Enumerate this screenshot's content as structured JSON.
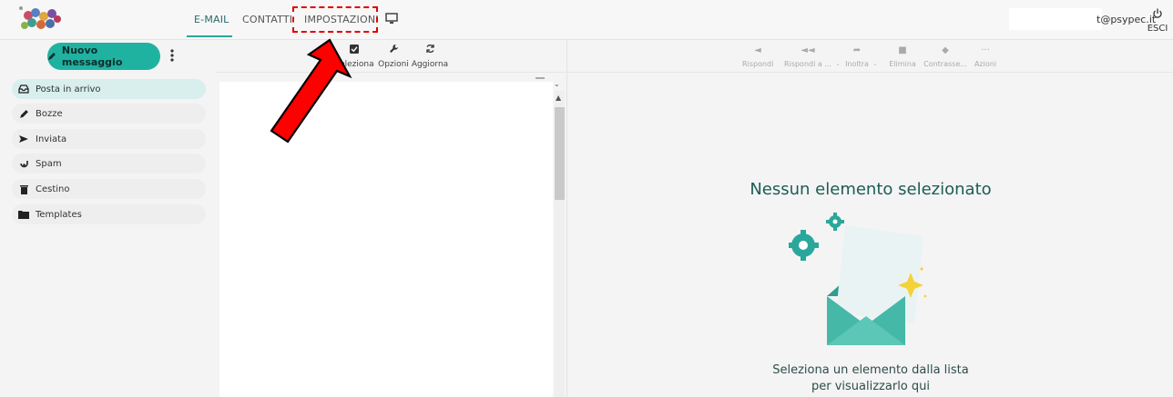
{
  "header": {
    "tabs": [
      {
        "label": "E-MAIL",
        "active": true
      },
      {
        "label": "CONTATTI",
        "active": false
      },
      {
        "label": "IMPOSTAZIONI",
        "active": false
      }
    ],
    "user_email": "t@psypec.it",
    "logout_label": "ESCI"
  },
  "sidebar": {
    "compose_label": "Nuovo messaggio",
    "folders": [
      {
        "label": "Posta in arrivo",
        "icon": "inbox-icon",
        "active": true
      },
      {
        "label": "Bozze",
        "icon": "pencil-icon",
        "active": false
      },
      {
        "label": "Inviata",
        "icon": "send-icon",
        "active": false
      },
      {
        "label": "Spam",
        "icon": "spam-icon",
        "active": false
      },
      {
        "label": "Cestino",
        "icon": "trash-icon",
        "active": false
      },
      {
        "label": "Templates",
        "icon": "folder-icon",
        "active": false
      }
    ]
  },
  "list_toolbar": {
    "select_label": "Seleziona",
    "options_label": "Opzioni",
    "refresh_label": "Aggiorna"
  },
  "read_toolbar": {
    "reply_label": "Rispondi",
    "reply_all_label": "Rispondi a ...",
    "forward_label": "Inoltra",
    "delete_label": "Elimina",
    "mark_label": "Contrasse...",
    "actions_label": "Azioni"
  },
  "reading_pane": {
    "empty_title": "Nessun elemento selezionato",
    "empty_hint_line1": "Seleziona un elemento dalla lista",
    "empty_hint_line2": "per visualizzarlo qui"
  },
  "colors": {
    "accent": "#20b2a0",
    "annotation": "#e00000"
  }
}
